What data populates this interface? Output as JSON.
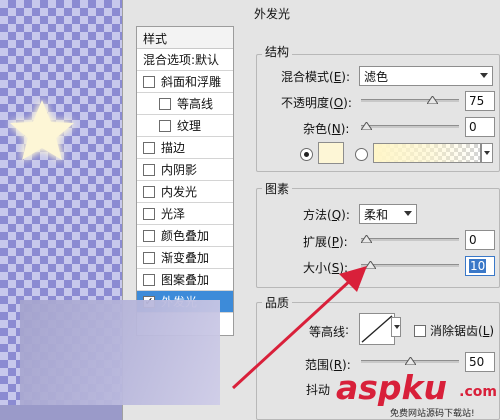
{
  "panel": {
    "title": "外发光"
  },
  "styles": {
    "header": "样式",
    "blend_options": "混合选项:默认",
    "items": [
      {
        "label": "斜面和浮雕",
        "checked": false
      },
      {
        "label": "等高线",
        "checked": false
      },
      {
        "label": "纹理",
        "checked": false
      },
      {
        "label": "描边",
        "checked": false
      },
      {
        "label": "内阴影",
        "checked": false
      },
      {
        "label": "内发光",
        "checked": false
      },
      {
        "label": "光泽",
        "checked": false
      },
      {
        "label": "颜色叠加",
        "checked": false
      },
      {
        "label": "渐变叠加",
        "checked": false
      },
      {
        "label": "图案叠加",
        "checked": false
      },
      {
        "label": "外发光",
        "checked": true
      }
    ],
    "check_mark": "✓"
  },
  "structure": {
    "title": "结构",
    "blend_mode_label": "混合模式",
    "blend_mode_key": "E",
    "blend_mode_value": "滤色",
    "opacity_label": "不透明度",
    "opacity_key": "O",
    "opacity_value": "75",
    "noise_label": "杂色",
    "noise_key": "N",
    "noise_value": "0",
    "glow_color": "#fdf6d6",
    "opacity_fraction": 0.75,
    "noise_fraction": 0.0
  },
  "elements": {
    "title": "图素",
    "method_label": "方法",
    "method_key": "Q",
    "method_value": "柔和",
    "spread_label": "扩展",
    "spread_key": "P",
    "spread_value": "0",
    "size_label": "大小",
    "size_key": "S",
    "size_value": "10",
    "spread_fraction": 0.0,
    "size_fraction": 0.04
  },
  "quality": {
    "title": "品质",
    "contour_label": "等高线",
    "antialias_label": "消除锯齿",
    "antialias_key": "L",
    "range_label": "范围",
    "range_key": "R",
    "range_value": "50",
    "jitter_label": "抖动",
    "range_fraction": 0.5
  },
  "watermark": {
    "brand": "aspku",
    "domain": ".com",
    "tagline": "免费网站源码下载站!"
  },
  "colors": {
    "selection": "#3d8bd9",
    "arrow": "#d9203a"
  }
}
